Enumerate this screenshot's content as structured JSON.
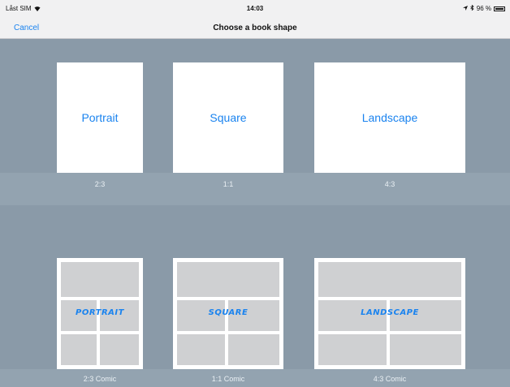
{
  "status": {
    "carrier": "Låst SIM",
    "time": "14:03",
    "battery": "96 %",
    "icons": [
      "wifi-icon",
      "location-icon",
      "bluetooth-icon",
      "battery-icon"
    ]
  },
  "nav": {
    "cancel": "Cancel",
    "title": "Choose a book shape"
  },
  "shapes": [
    {
      "label": "Portrait",
      "ratio": "2:3"
    },
    {
      "label": "Square",
      "ratio": "1:1"
    },
    {
      "label": "Landscape",
      "ratio": "4:3"
    }
  ],
  "comics": [
    {
      "label": "PORTRAIT",
      "ratio": "2:3 Comic"
    },
    {
      "label": "SQUARE",
      "ratio": "1:1 Comic"
    },
    {
      "label": "LANDSCAPE",
      "ratio": "4:3 Comic"
    }
  ],
  "colors": {
    "accent": "#1a83ef",
    "background": "#8a9aa8",
    "panel": "#cfd0d2"
  }
}
